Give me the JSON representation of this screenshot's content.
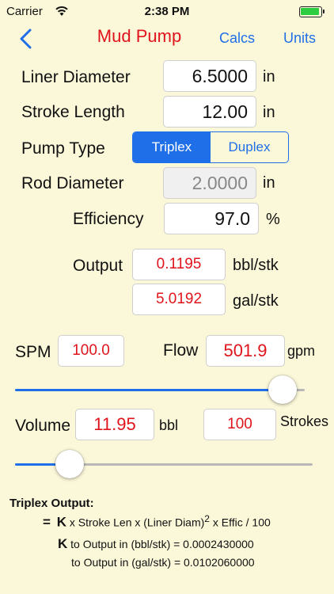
{
  "status": {
    "carrier": "Carrier",
    "time": "2:38 PM"
  },
  "nav": {
    "title": "Mud Pump",
    "calcs": "Calcs",
    "units": "Units"
  },
  "liner": {
    "label": "Liner Diameter",
    "value": "6.5000",
    "unit": "in"
  },
  "stroke": {
    "label": "Stroke Length",
    "value": "12.00",
    "unit": "in"
  },
  "pump_type": {
    "label": "Pump Type",
    "options": [
      "Triplex",
      "Duplex"
    ],
    "selected": "Triplex"
  },
  "rod": {
    "label": "Rod Diameter",
    "value": "2.0000",
    "unit": "in"
  },
  "efficiency": {
    "label": "Efficiency",
    "value": "97.0",
    "unit": "%"
  },
  "output": {
    "label": "Output",
    "bbl_value": "0.1195",
    "bbl_unit": "bbl/stk",
    "gal_value": "5.0192",
    "gal_unit": "gal/stk"
  },
  "spm": {
    "label": "SPM",
    "value": "100.0"
  },
  "flow": {
    "label": "Flow",
    "value": "501.9",
    "unit": "gpm"
  },
  "spm_slider": {
    "level": 0.97,
    "fill_color": "#1f6fe8",
    "track_color": "#b8b8b8"
  },
  "volume": {
    "label": "Volume",
    "value": "11.95",
    "unit": "bbl",
    "strokes_value": "100",
    "strokes_label": "Strokes"
  },
  "volume_slider": {
    "level": 0.15
  },
  "formula": {
    "heading": "Triplex Output:",
    "eq": "=",
    "k": "K",
    "line1": "x Stroke Len x (Liner Diam)",
    "sup": "2",
    "line1_tail": "x Effic / 100",
    "line2": "to Output in (bbl/stk) = 0.0002430000",
    "line3": "to Output in (gal/stk) = 0.0102060000"
  },
  "icons": {
    "wifi": "wifi-icon",
    "battery": "battery-icon",
    "back": "chevron-left-icon"
  }
}
